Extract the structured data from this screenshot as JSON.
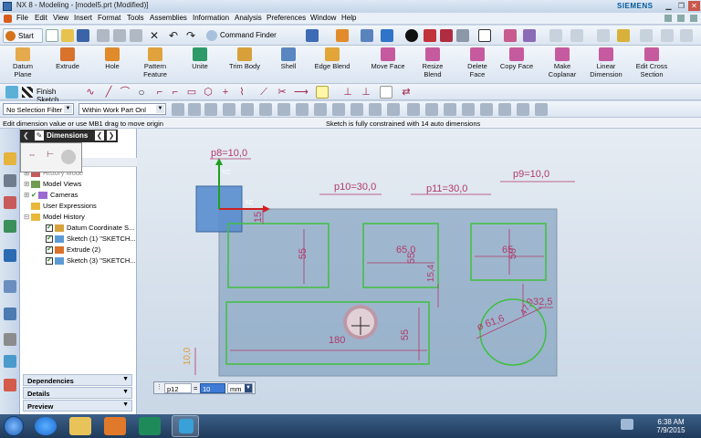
{
  "window": {
    "title": "NX 8 - Modeling - [model5.prt (Modified)]",
    "brand": "SIEMENS"
  },
  "menu": [
    "File",
    "Edit",
    "View",
    "Insert",
    "Format",
    "Tools",
    "Assemblies",
    "Information",
    "Analysis",
    "Preferences",
    "Window",
    "Help"
  ],
  "toolbar1": {
    "start_label": "Start",
    "command_finder_label": "Command Finder"
  },
  "feature_tools": [
    {
      "label": "Datum\nPlane",
      "icon": "datum-plane-icon"
    },
    {
      "label": "Extrude",
      "icon": "extrude-icon"
    },
    {
      "label": "Hole",
      "icon": "hole-icon"
    },
    {
      "label": "Pattern\nFeature",
      "icon": "pattern-feature-icon"
    },
    {
      "label": "Unite",
      "icon": "unite-icon"
    },
    {
      "label": "Trim Body",
      "icon": "trim-body-icon"
    },
    {
      "label": "Shell",
      "icon": "shell-icon"
    },
    {
      "label": "Edge Blend",
      "icon": "edge-blend-icon"
    },
    {
      "label": "Move Face",
      "icon": "move-face-icon"
    },
    {
      "label": "Resize\nBlend",
      "icon": "resize-blend-icon"
    },
    {
      "label": "Delete\nFace",
      "icon": "delete-face-icon"
    },
    {
      "label": "Copy Face",
      "icon": "copy-face-icon"
    },
    {
      "label": "Make\nCoplanar",
      "icon": "make-coplanar-icon"
    },
    {
      "label": "Linear\nDimension",
      "icon": "linear-dimension-icon"
    },
    {
      "label": "Edit Cross\nSection",
      "icon": "edit-cross-section-icon"
    }
  ],
  "sketch_toolbar": {
    "finish_sketch_label": "Finish Sketch"
  },
  "filters": {
    "selection_filter": "No Selection Filter",
    "scope": "Within Work Part Onl"
  },
  "status": {
    "prompt": "Edit dimension value or use MB1 drag to move origin",
    "message": "Sketch is fully constrained with 14 auto dimensions"
  },
  "dimensions_dialog": {
    "title": "Dimensions"
  },
  "navigator": {
    "items": [
      {
        "label": "History Mode",
        "indent": 1
      },
      {
        "label": "Model Views",
        "indent": 1
      },
      {
        "label": "Cameras",
        "indent": 1
      },
      {
        "label": "User Expressions",
        "indent": 1
      },
      {
        "label": "Model History",
        "indent": 1
      },
      {
        "label": "Datum Coordinate S...",
        "indent": 2
      },
      {
        "label": "Sketch (1) \"SKETCH...",
        "indent": 2
      },
      {
        "label": "Extrude (2)",
        "indent": 2
      },
      {
        "label": "Sketch (3) \"SKETCH...",
        "indent": 2
      }
    ],
    "sections": [
      "Dependencies",
      "Details",
      "Preview"
    ]
  },
  "sketch": {
    "dims": {
      "p8": "p8=10,0",
      "p9": "p9=10,0",
      "p10": "p10=30,0",
      "p11": "p11=30,0",
      "d15": "15",
      "d55a": "55",
      "d65a": "65,0",
      "d55b": "55",
      "d65b": "65",
      "d50": "50",
      "d15_4": "15,4",
      "d32_5": "32,5",
      "d47_9": "47,9",
      "d61_6": "ø 61,6",
      "d180": "180",
      "d55c": "55",
      "d10": "10,0"
    },
    "colors": {
      "dimension": "#b03a6a",
      "sketch_line": "#3fbf3f",
      "body": "#7f9fbe"
    }
  },
  "dim_input": {
    "name": "p12",
    "equals": "=",
    "value": "10",
    "unit": "mm"
  },
  "taskbar": {
    "time": "6:38 AM",
    "date": "7/9/2015"
  }
}
